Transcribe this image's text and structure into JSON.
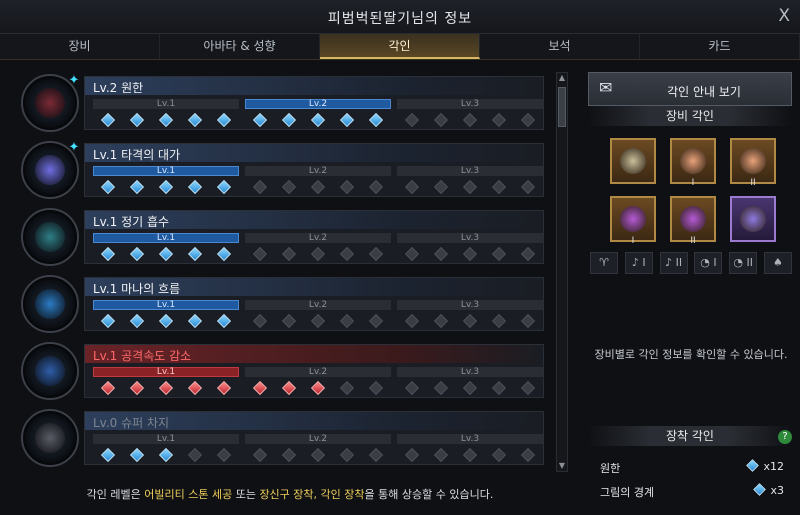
{
  "window": {
    "title": "피범벅된딸기님의 정보",
    "close_glyph": "X"
  },
  "tabs": [
    {
      "label": "장비"
    },
    {
      "label": "아바타 & 성향"
    },
    {
      "label": "각인",
      "active": true
    },
    {
      "label": "보석"
    },
    {
      "label": "카드"
    }
  ],
  "level_labels": [
    "Lv.1",
    "Lv.2",
    "Lv.3"
  ],
  "engravings": [
    {
      "name": "Lv.2 원한",
      "level": 2,
      "gems": 10,
      "style": "blue",
      "emblem": "#7a2a36",
      "gem_badge": "✦"
    },
    {
      "name": "Lv.1 타격의 대가",
      "level": 1,
      "gems": 5,
      "style": "blue",
      "emblem": "#6f6ee0",
      "gem_badge": "✦"
    },
    {
      "name": "Lv.1 정기 흡수",
      "level": 1,
      "gems": 5,
      "style": "blue",
      "emblem": "#2f7e86"
    },
    {
      "name": "Lv.1 마나의 흐름",
      "level": 1,
      "gems": 5,
      "style": "blue",
      "emblem": "#2c7bc4"
    },
    {
      "name": "Lv.1 공격속도 감소",
      "level": 1,
      "gems": 8,
      "style": "red",
      "emblem": "#2f5ea8"
    },
    {
      "name": "Lv.0 슈퍼 차지",
      "level": 0,
      "gems": 3,
      "style": "dim",
      "emblem": "#5a5d66"
    }
  ],
  "footer": {
    "prefix": "각인 레벨은 ",
    "hl1": "어빌리티 스톤 세공",
    "mid1": " 또는 ",
    "hl2": "장신구 장착, 각인 장착",
    "suffix": "을 통해 상승할 수 있습니다."
  },
  "sidebar": {
    "guide_button": "각인 안내 보기",
    "equip_title": "장비 각인",
    "slots": [
      {
        "num": "",
        "color": "#c9c09a"
      },
      {
        "num": "I",
        "color": "#e8a27a"
      },
      {
        "num": "II",
        "color": "#e8a27a"
      },
      {
        "num": "I",
        "color": "#b45ad6"
      },
      {
        "num": "II",
        "color": "#b45ad6"
      },
      {
        "num": "",
        "color": "#8f7ae0"
      }
    ],
    "filters": [
      "♈",
      "♪ I",
      "♪ II",
      "◔ I",
      "◔ II",
      "♠"
    ],
    "hint": "장비별로 각인 정보를 확인할 수 있습니다.",
    "mount_title": "장착 각인",
    "help": "?",
    "mounted": [
      {
        "name": "원한",
        "value": "x12"
      },
      {
        "name": "그림의 경계",
        "value": "x3"
      }
    ]
  }
}
